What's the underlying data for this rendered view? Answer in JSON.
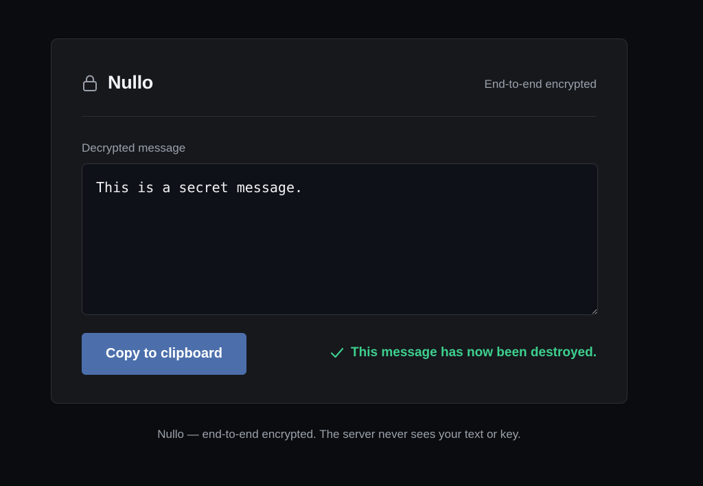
{
  "header": {
    "brand": "Nullo",
    "brand_icon": "lock-icon",
    "tag": "End-to-end encrypted"
  },
  "message": {
    "label": "Decrypted message",
    "value": "This is a secret message."
  },
  "actions": {
    "copy_label": "Copy to clipboard"
  },
  "status": {
    "icon": "check-icon",
    "text": "This message has now been destroyed.",
    "color": "#3ecf8e"
  },
  "footer": {
    "text": "Nullo — end-to-end encrypted. The server never sees your text or key."
  },
  "colors": {
    "accent": "#4c6fac",
    "background": "#0b0c0f",
    "card": "#16181c"
  }
}
